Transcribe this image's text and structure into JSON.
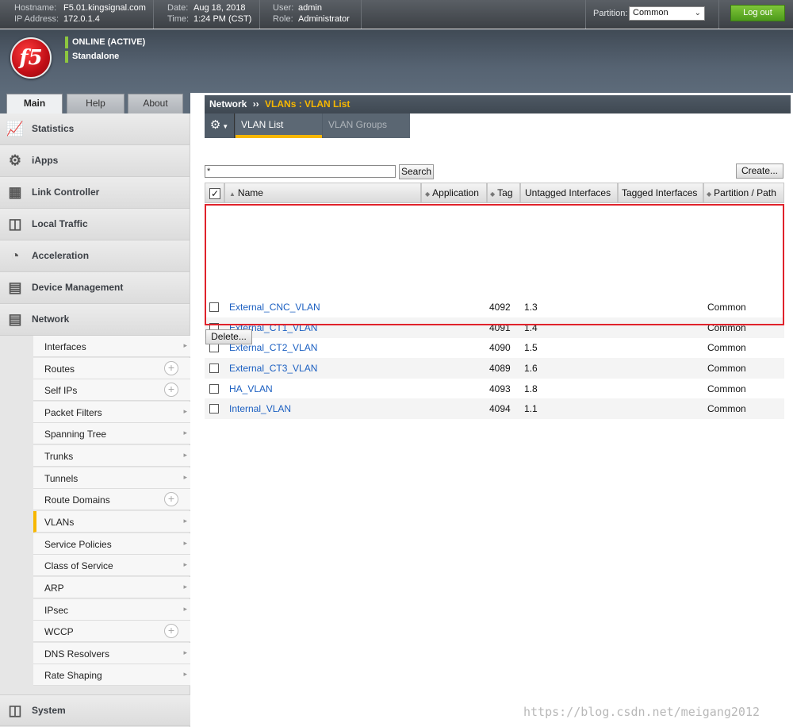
{
  "topbar": {
    "hostname_label": "Hostname:",
    "hostname": "F5.01.kingsignal.com",
    "ip_label": "IP Address:",
    "ip": "172.0.1.4",
    "date_label": "Date:",
    "date": "Aug 18, 2018",
    "time_label": "Time:",
    "time": "1:24 PM (CST)",
    "user_label": "User:",
    "user": "admin",
    "role_label": "Role:",
    "role": "Administrator",
    "partition_label": "Partition:",
    "partition_value": "Common",
    "logout_label": "Log out"
  },
  "banner": {
    "logo_text": "f5",
    "status": "ONLINE (ACTIVE)",
    "mode": "Standalone"
  },
  "tabs": [
    {
      "label": "Main",
      "active": true
    },
    {
      "label": "Help",
      "active": false
    },
    {
      "label": "About",
      "active": false
    }
  ],
  "sidebar": {
    "sections": [
      {
        "label": "Statistics",
        "icon": "statistics-icon"
      },
      {
        "label": "iApps",
        "icon": "iapps-icon"
      },
      {
        "label": "Link Controller",
        "icon": "link-controller-icon"
      },
      {
        "label": "Local Traffic",
        "icon": "local-traffic-icon"
      },
      {
        "label": "Acceleration",
        "icon": "acceleration-icon"
      },
      {
        "label": "Device Management",
        "icon": "device-management-icon"
      },
      {
        "label": "Network",
        "icon": "network-icon"
      }
    ],
    "network_items": [
      {
        "label": "Interfaces",
        "control": "arrow"
      },
      {
        "label": "Routes",
        "control": "plus"
      },
      {
        "label": "Self IPs",
        "control": "plus"
      },
      {
        "label": "Packet Filters",
        "control": "arrow"
      },
      {
        "label": "Spanning Tree",
        "control": "arrow"
      },
      {
        "label": "Trunks",
        "control": "arrow"
      },
      {
        "label": "Tunnels",
        "control": "arrow"
      },
      {
        "label": "Route Domains",
        "control": "plus"
      },
      {
        "label": "VLANs",
        "control": "arrow",
        "active": true
      },
      {
        "label": "Service Policies",
        "control": "arrow"
      },
      {
        "label": "Class of Service",
        "control": "arrow"
      },
      {
        "label": "ARP",
        "control": "arrow"
      },
      {
        "label": "IPsec",
        "control": "arrow"
      },
      {
        "label": "WCCP",
        "control": "plus"
      },
      {
        "label": "DNS Resolvers",
        "control": "arrow"
      },
      {
        "label": "Rate Shaping",
        "control": "arrow"
      }
    ],
    "system_label": "System"
  },
  "breadcrumb": {
    "root": "Network",
    "separator": "››",
    "current": "VLANs : VLAN List"
  },
  "subtabs": [
    {
      "label": "VLAN List",
      "active": true
    },
    {
      "label": "VLAN Groups",
      "active": false
    }
  ],
  "search": {
    "value": "*",
    "button_label": "Search"
  },
  "create_label": "Create...",
  "delete_label": "Delete...",
  "table": {
    "headers": [
      "Name",
      "Application",
      "Tag",
      "Untagged Interfaces",
      "Tagged Interfaces",
      "Partition / Path"
    ],
    "rows": [
      {
        "name": "External_CNC_VLAN",
        "application": "",
        "tag": "4092",
        "untagged": "1.3",
        "tagged": "",
        "partition": "Common"
      },
      {
        "name": "External_CT1_VLAN",
        "application": "",
        "tag": "4091",
        "untagged": "1.4",
        "tagged": "",
        "partition": "Common"
      },
      {
        "name": "External_CT2_VLAN",
        "application": "",
        "tag": "4090",
        "untagged": "1.5",
        "tagged": "",
        "partition": "Common"
      },
      {
        "name": "External_CT3_VLAN",
        "application": "",
        "tag": "4089",
        "untagged": "1.6",
        "tagged": "",
        "partition": "Common"
      },
      {
        "name": "HA_VLAN",
        "application": "",
        "tag": "4093",
        "untagged": "1.8",
        "tagged": "",
        "partition": "Common"
      },
      {
        "name": "Internal_VLAN",
        "application": "",
        "tag": "4094",
        "untagged": "1.1",
        "tagged": "",
        "partition": "Common"
      }
    ]
  },
  "watermark": "https://blog.csdn.net/meigang2012",
  "colors": {
    "accent": "#f7b700",
    "link": "#1b5fc1",
    "highlight": "#e0222b",
    "online": "#8dc63f"
  }
}
